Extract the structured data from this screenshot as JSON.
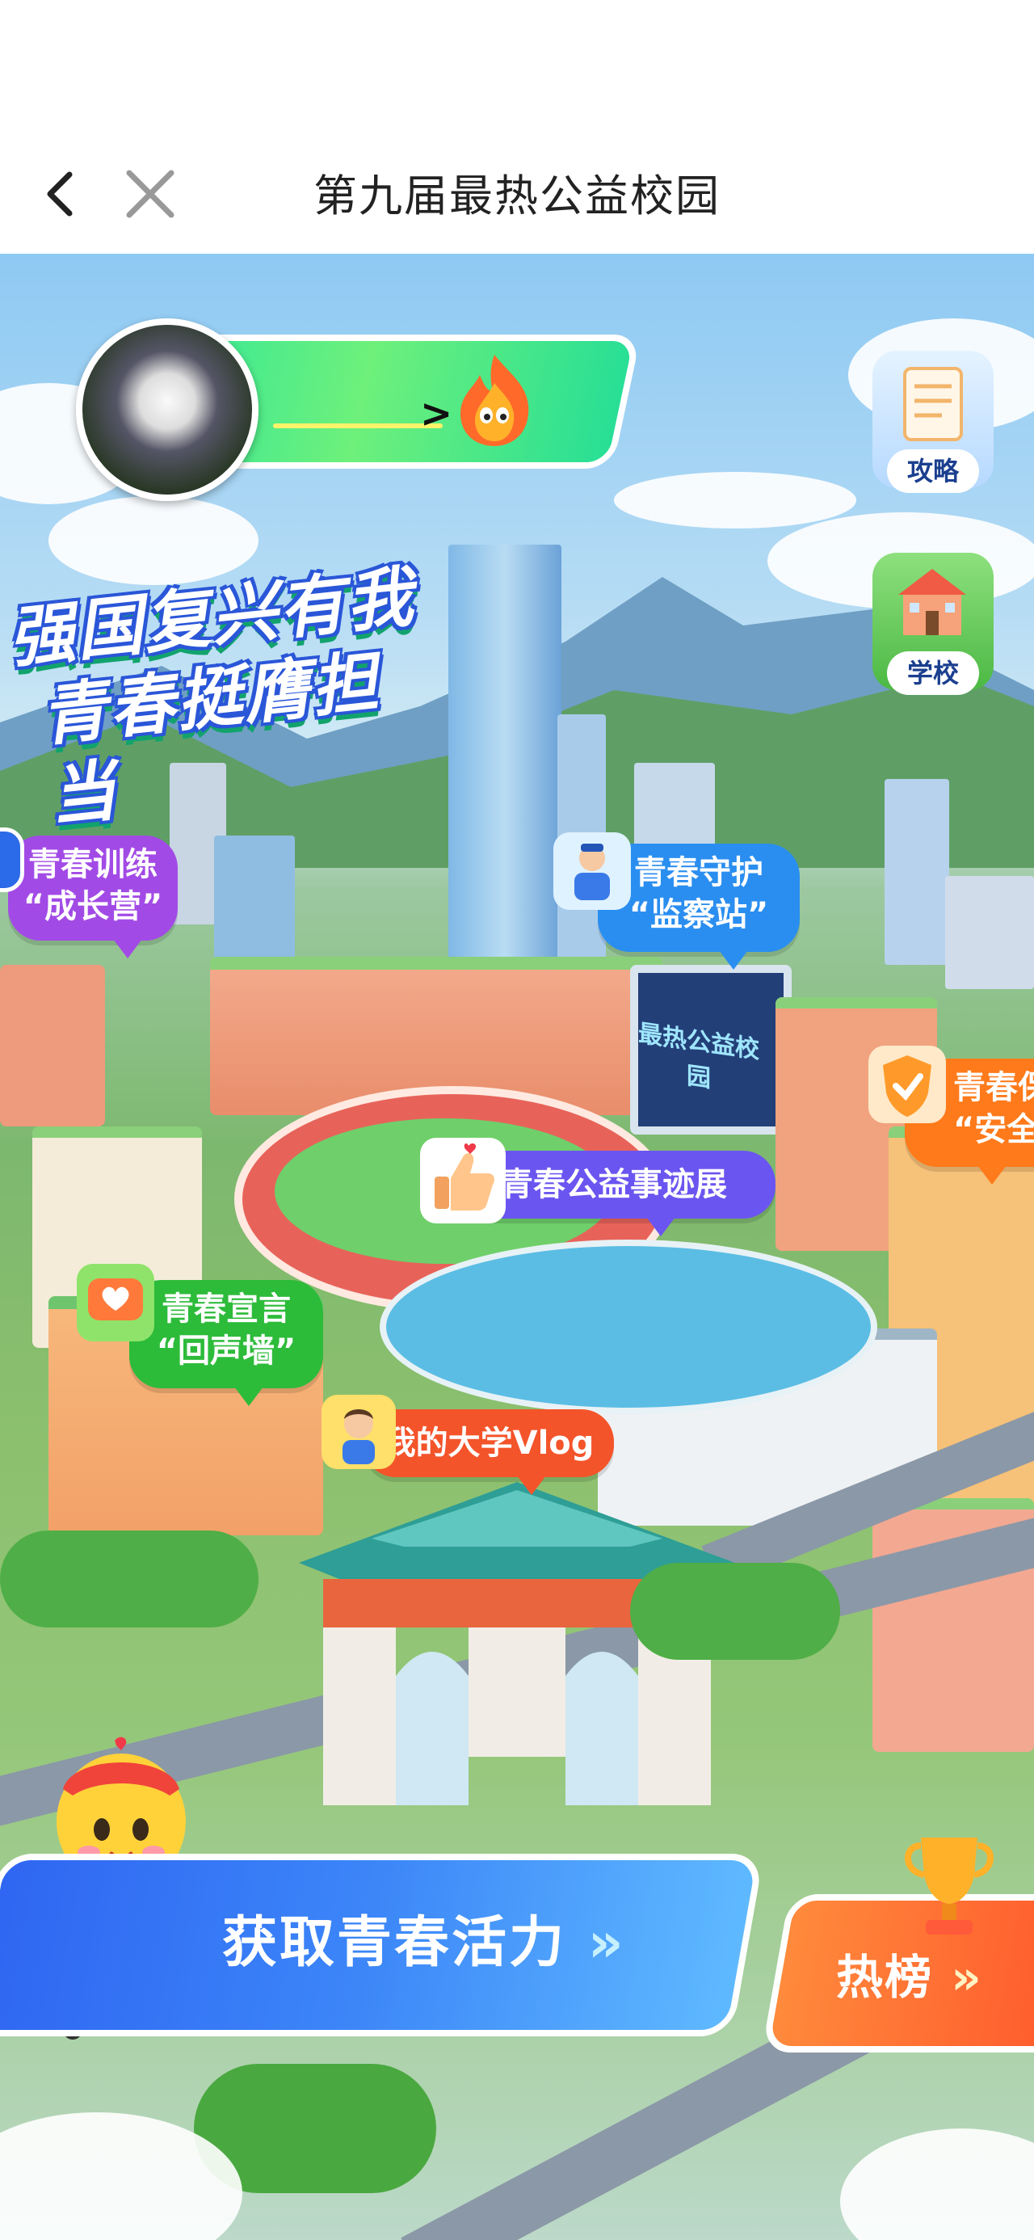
{
  "nav": {
    "title": "第九届最热公益校园"
  },
  "side_buttons": [
    {
      "label": "攻略"
    },
    {
      "label": "学校"
    }
  ],
  "slogan": {
    "line1": "强国复兴有我",
    "line2": "青春挺膺担当"
  },
  "screen_sign": "最热公益校园",
  "bubbles": {
    "training": {
      "line1": "青春训练",
      "line2": "“成长营”"
    },
    "guard": {
      "line1": "青春守护",
      "line2": "“监察站”"
    },
    "safety": {
      "line1": "青春保",
      "line2": "“安全"
    },
    "exhibit": {
      "line1": "青春公益事迹展"
    },
    "voice": {
      "line1": "青春宣言",
      "line2": "“回声墙”"
    },
    "vlog": {
      "line1": "我的大学Vlog"
    }
  },
  "cta": {
    "main_label": "获取青春活力",
    "hot_label": "热榜"
  },
  "colors": {
    "profile_green": "#2fe38f",
    "main_blue": "#2f66f2",
    "hot_orange": "#ff6a2c",
    "purple_bubble": "#a24ae6",
    "blue_bubble": "#2a8ef0",
    "orange_bubble": "#ff7a1a",
    "green_bubble": "#2dbb3a",
    "red_bubble": "#f4542a"
  }
}
